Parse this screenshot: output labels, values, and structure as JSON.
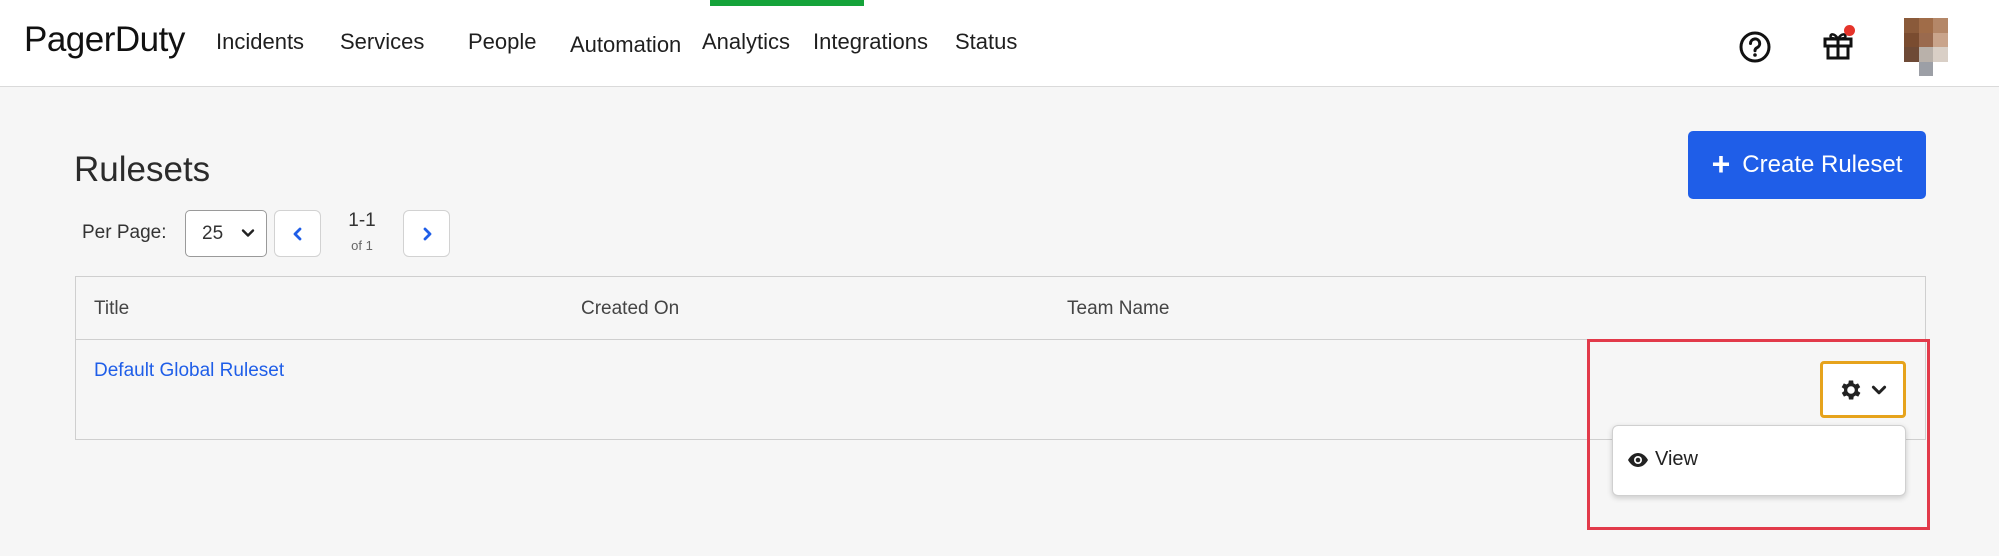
{
  "brand": {
    "name": "PagerDuty"
  },
  "nav": {
    "items": [
      {
        "label": "Incidents",
        "active": false
      },
      {
        "label": "Services",
        "active": false
      },
      {
        "label": "People",
        "active": false
      },
      {
        "label": "Automation",
        "active": true
      },
      {
        "label": "Analytics",
        "active": false
      },
      {
        "label": "Integrations",
        "active": false
      },
      {
        "label": "Status",
        "active": false
      }
    ],
    "active_color": "#15a33a",
    "icons": [
      "help-icon",
      "gift-icon",
      "avatar"
    ],
    "notification_dot_color": "#e5332a"
  },
  "page": {
    "title": "Rulesets",
    "create_button_label": "Create Ruleset",
    "accent_color": "#1f5ee8"
  },
  "pagination": {
    "per_page_label": "Per Page:",
    "per_page_value": "25",
    "range": "1-1",
    "of": "of 1"
  },
  "table": {
    "columns": [
      "Title",
      "Created On",
      "Team Name"
    ],
    "rows": [
      {
        "title": "Default Global Ruleset",
        "created_on": "",
        "team_name": ""
      }
    ]
  },
  "actions_menu": {
    "items": [
      {
        "label": "View",
        "icon": "eye-icon"
      }
    ]
  }
}
